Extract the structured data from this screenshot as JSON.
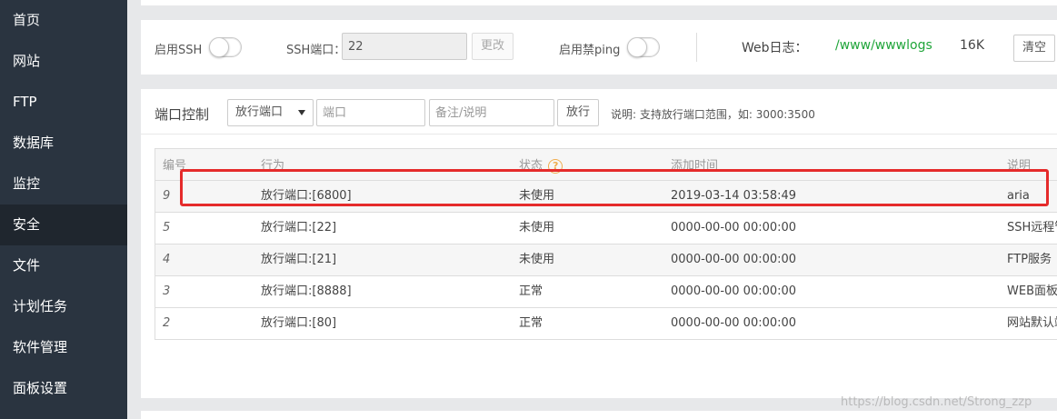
{
  "sidebar": {
    "items": [
      {
        "label": "首页"
      },
      {
        "label": "网站"
      },
      {
        "label": "FTP"
      },
      {
        "label": "数据库"
      },
      {
        "label": "监控"
      },
      {
        "label": "安全",
        "active": true
      },
      {
        "label": "文件"
      },
      {
        "label": "计划任务"
      },
      {
        "label": "软件管理"
      },
      {
        "label": "面板设置"
      }
    ]
  },
  "ssh": {
    "enable_ssh_label": "启用SSH",
    "enable_ssh_on": false,
    "ssh_port_label": "SSH端口：",
    "ssh_port_value": "22",
    "change_button": "更改",
    "disable_ping_label": "启用禁ping",
    "disable_ping_on": false,
    "web_log_label": "Web日志：",
    "web_log_path": "/www/wwwlogs",
    "web_log_size": "16K",
    "clear_button": "清空"
  },
  "firewall": {
    "title": "端口控制",
    "action_select": "放行端口",
    "port_placeholder": "端口",
    "note_placeholder": "备注/说明",
    "submit_button": "放行",
    "hint": "说明: 支持放行端口范围，如: 3000:3500",
    "columns": [
      "编号",
      "行为",
      "状态",
      "添加时间",
      "说明"
    ],
    "rows": [
      {
        "id": "9",
        "action": "放行端口:[6800]",
        "status": "未使用",
        "time": "2019-03-14 03:58:49",
        "note": "aria"
      },
      {
        "id": "5",
        "action": "放行端口:[22]",
        "status": "未使用",
        "time": "0000-00-00 00:00:00",
        "note": "SSH远程管"
      },
      {
        "id": "4",
        "action": "放行端口:[21]",
        "status": "未使用",
        "time": "0000-00-00 00:00:00",
        "note": "FTP服务"
      },
      {
        "id": "3",
        "action": "放行端口:[8888]",
        "status": "正常",
        "time": "0000-00-00 00:00:00",
        "note": "WEB面板"
      },
      {
        "id": "2",
        "action": "放行端口:[80]",
        "status": "正常",
        "time": "0000-00-00 00:00:00",
        "note": "网站默认端"
      }
    ]
  },
  "watermark": "https://blog.csdn.net/Strong_zzp",
  "colors": {
    "sidebar_bg": "#2a3440",
    "log_path": "#20a53a",
    "help_icon": "#f0ad4e",
    "highlight": "#e52b2b"
  },
  "icons": {
    "help": "question-circle-icon",
    "dropdown": "caret-down-icon"
  }
}
